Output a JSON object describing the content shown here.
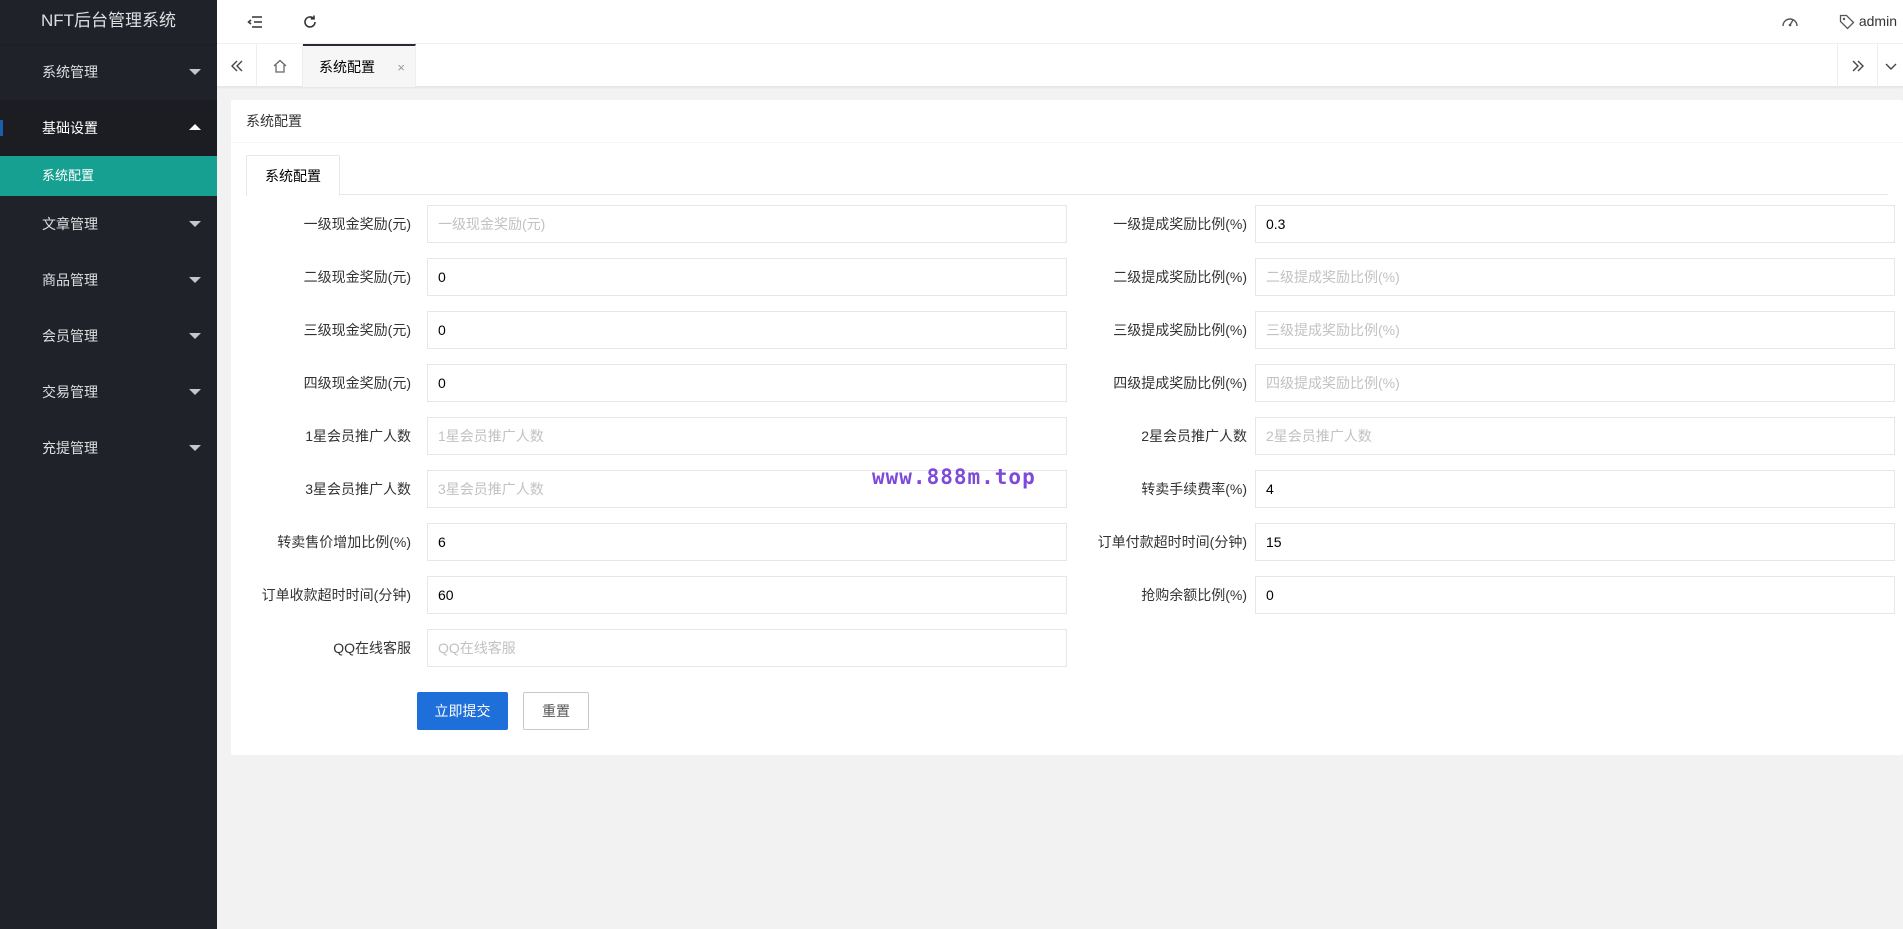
{
  "app": {
    "title": "NFT后台管理系统"
  },
  "sidebar": {
    "items": [
      {
        "label": "系统管理"
      },
      {
        "label": "基础设置",
        "children": [
          {
            "label": "系统配置"
          }
        ]
      },
      {
        "label": "文章管理"
      },
      {
        "label": "商品管理"
      },
      {
        "label": "会员管理"
      },
      {
        "label": "交易管理"
      },
      {
        "label": "充提管理"
      }
    ]
  },
  "header": {
    "user": "admin",
    "icons": [
      "menu-collapse-icon",
      "refresh-icon",
      "dashboard-icon",
      "tag-icon"
    ]
  },
  "tabs": {
    "active": "系统配置",
    "close": "×"
  },
  "card": {
    "title": "系统配置",
    "inner_tab": "系统配置"
  },
  "form": {
    "fields": [
      {
        "label": "一级现金奖励(元)",
        "value": "",
        "placeholder": "一级现金奖励(元)"
      },
      {
        "label": "一级提成奖励比例(%)",
        "value": "0.3",
        "placeholder": "一级提成奖励比例(%)"
      },
      {
        "label": "二级现金奖励(元)",
        "value": "0",
        "placeholder": "二级现金奖励(元)"
      },
      {
        "label": "二级提成奖励比例(%)",
        "value": "",
        "placeholder": "二级提成奖励比例(%)"
      },
      {
        "label": "三级现金奖励(元)",
        "value": "0",
        "placeholder": "三级现金奖励(元)"
      },
      {
        "label": "三级提成奖励比例(%)",
        "value": "",
        "placeholder": "三级提成奖励比例(%)"
      },
      {
        "label": "四级现金奖励(元)",
        "value": "0",
        "placeholder": "四级现金奖励(元)"
      },
      {
        "label": "四级提成奖励比例(%)",
        "value": "",
        "placeholder": "四级提成奖励比例(%)"
      },
      {
        "label": "1星会员推广人数",
        "value": "",
        "placeholder": "1星会员推广人数"
      },
      {
        "label": "2星会员推广人数",
        "value": "",
        "placeholder": "2星会员推广人数"
      },
      {
        "label": "3星会员推广人数",
        "value": "",
        "placeholder": "3星会员推广人数"
      },
      {
        "label": "转卖手续费率(%)",
        "value": "4",
        "placeholder": "转卖手续费率(%)"
      },
      {
        "label": "转卖售价增加比例(%)",
        "value": "6",
        "placeholder": "转卖售价增加比例(%)"
      },
      {
        "label": "订单付款超时时间(分钟)",
        "value": "15",
        "placeholder": "订单付款超时时间(分钟)"
      },
      {
        "label": "订单收款超时时间(分钟)",
        "value": "60",
        "placeholder": "订单收款超时时间(分钟)"
      },
      {
        "label": "抢购余额比例(%)",
        "value": "0",
        "placeholder": "抢购余额比例(%)"
      },
      {
        "label": "QQ在线客服",
        "value": "",
        "placeholder": "QQ在线客服"
      }
    ],
    "submit_label": "立即提交",
    "reset_label": "重置"
  },
  "watermark": "www.888m.top",
  "colors": {
    "sidebar_bg": "#20222a",
    "active_child": "#16a091",
    "primary_button": "#1e6fd9",
    "watermark": "#7e4ad9"
  }
}
